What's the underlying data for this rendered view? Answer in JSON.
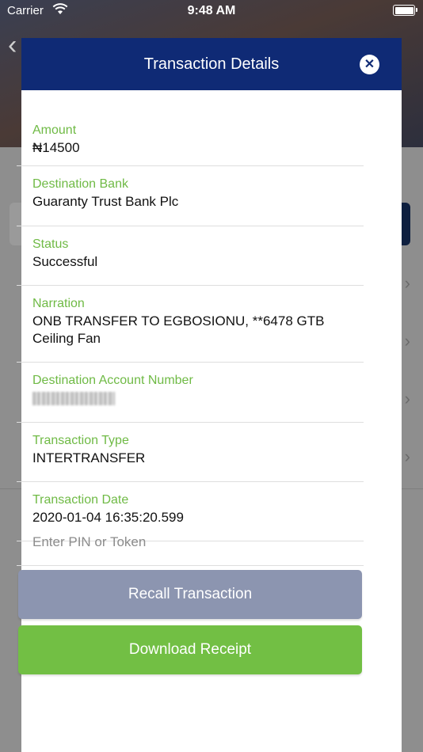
{
  "status_bar": {
    "carrier": "Carrier",
    "time": "9:48 AM"
  },
  "modal": {
    "title": "Transaction Details",
    "fields": [
      {
        "label": "Amount",
        "value": "₦14500"
      },
      {
        "label": "Destination Bank",
        "value": "Guaranty Trust Bank Plc"
      },
      {
        "label": "Status",
        "value": "Successful"
      },
      {
        "label": "Narration",
        "value": "ONB TRANSFER TO EGBOSIONU, **6478 GTB Ceiling Fan"
      },
      {
        "label": "Destination Account Number",
        "value": ""
      },
      {
        "label": "Transaction Type",
        "value": "INTERTRANSFER"
      },
      {
        "label": "Transaction Date",
        "value": "2020-01-04 16:35:20.599"
      }
    ],
    "pin_placeholder": "Enter PIN or Token",
    "recall_button": "Recall Transaction",
    "download_button": "Download Receipt"
  },
  "colors": {
    "header": "#0f2a75",
    "label_green": "#6fba45",
    "recall": "#8c95b0",
    "download": "#72bf44"
  }
}
